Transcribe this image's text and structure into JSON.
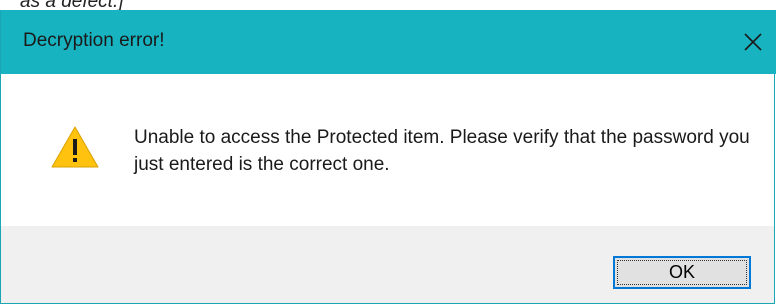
{
  "background_caption": "as a defect.]",
  "dialog": {
    "title": "Decryption error!",
    "close_icon": "close-icon",
    "warning_icon": "warning-icon",
    "message": "Unable to access the Protected item. Please verify that the password you just entered is the correct one.",
    "ok_label": "OK"
  },
  "colors": {
    "titlebar": "#17b3c0",
    "footer": "#f0f0f0",
    "button_border": "#0078d7",
    "warning_yellow": "#ffc20e"
  }
}
